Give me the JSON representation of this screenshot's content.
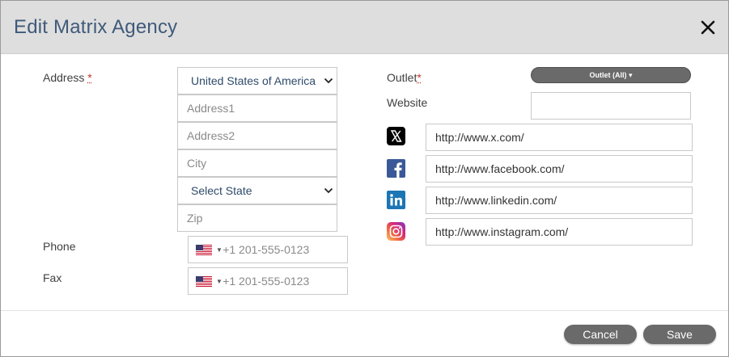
{
  "dialog": {
    "title": "Edit Matrix Agency"
  },
  "address": {
    "label": "Address",
    "required_mark": "*",
    "country": "United States of America",
    "address1_placeholder": "Address1",
    "address2_placeholder": "Address2",
    "city_placeholder": "City",
    "state": "Select State",
    "zip_placeholder": "Zip"
  },
  "phone": {
    "label": "Phone",
    "placeholder": "+1 201-555-0123"
  },
  "fax": {
    "label": "Fax",
    "placeholder": "+1 201-555-0123"
  },
  "outlet": {
    "label": "Outlet",
    "required_mark": "*",
    "button_label": "Outlet (All) ▾"
  },
  "website": {
    "label": "Website",
    "value": ""
  },
  "social": [
    {
      "icon": "x-icon",
      "value": "http://www.x.com/"
    },
    {
      "icon": "facebook-icon",
      "value": "http://www.facebook.com/"
    },
    {
      "icon": "linkedin-icon",
      "value": "http://www.linkedin.com/"
    },
    {
      "icon": "instagram-icon",
      "value": "http://www.instagram.com/"
    }
  ],
  "footer": {
    "cancel_label": "Cancel",
    "save_label": "Save"
  },
  "colors": {
    "header_bg": "#dedede",
    "title": "#3f5a7a",
    "button_bg": "#6a6a6a"
  }
}
